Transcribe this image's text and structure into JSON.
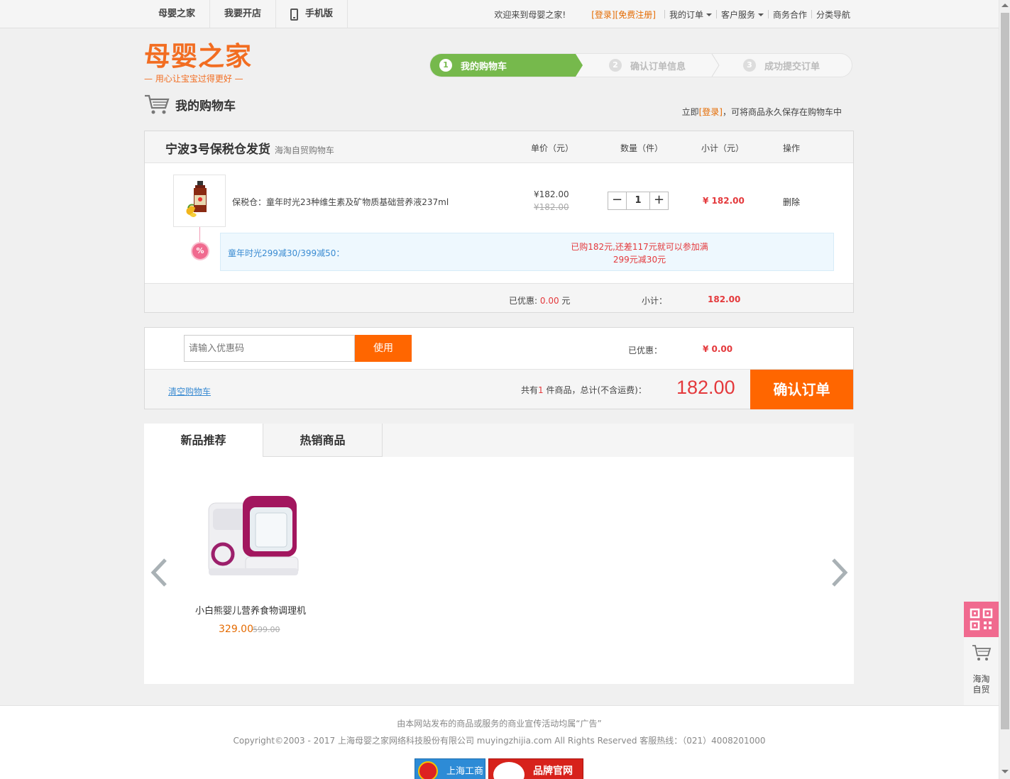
{
  "topbar": {
    "nav": [
      "母婴之家",
      "我要开店",
      "手机版"
    ],
    "welcome": "欢迎来到母婴之家!",
    "login": "[登录]",
    "register": "[免费注册]",
    "my_orders": "我的订单",
    "customer_service": "客户服务",
    "business": "商务合作",
    "category_nav": "分类导航"
  },
  "logo": {
    "title": "母婴之家",
    "slogan": "— 用心让宝宝过得更好 —"
  },
  "steps": [
    {
      "num": "1",
      "label": "我的购物车"
    },
    {
      "num": "2",
      "label": "确认订单信息"
    },
    {
      "num": "3",
      "label": "成功提交订单"
    }
  ],
  "cart": {
    "title": "我的购物车",
    "note_prefix": "立即",
    "note_login": "[登录]",
    "note_suffix": "，可将商品永久保存在购物车中",
    "warehouse": "宁波3号保税仓发货",
    "warehouse_sub": "海淘自贸购物车",
    "columns": {
      "price": "单价（元）",
      "qty": "数量（件）",
      "subtotal": "小计（元）",
      "action": "操作"
    },
    "item": {
      "name": "保税仓：童年时光23种维生素及矿物质基础营养液237ml",
      "price": "¥182.00",
      "price_old": "¥182.00",
      "qty": "1",
      "subtotal": "¥ 182.00",
      "delete": "删除"
    },
    "promo": {
      "badge": "%",
      "name": "童年时光299减30/399减50：",
      "msg1": "已购182元,还差117元就可以参加满",
      "msg2": "299元减30元"
    },
    "footer": {
      "discount_label": "已优惠:",
      "discount_value": "0.00",
      "discount_unit": "元",
      "subtotal_label": "小计：",
      "subtotal_value": "182.00"
    }
  },
  "coupon": {
    "placeholder": "请输入优惠码",
    "use_button": "使用",
    "discount_label": "已优惠：",
    "discount_value": "¥ 0.00",
    "clear_cart": "清空购物车",
    "total_prefix": "共有",
    "total_count": "1",
    "total_suffix": " 件商品，总计(不含运费)：",
    "total_value": "182.00",
    "confirm": "确认订单"
  },
  "recommend": {
    "tabs": [
      "新品推荐",
      "热销商品"
    ],
    "items": [
      {
        "name": "小白熊婴儿营养食物调理机",
        "price": "329.00",
        "old_price": "599.00"
      }
    ]
  },
  "footer": {
    "line1": "由本网站发布的商品或服务的商业宣传活动均属“广告”",
    "line2": "Copyright©2003 - 2017 上海母婴之家网络科技股份有限公司 muyingzhijia.com All Rights Reserved 客服热线：（021）4008201000",
    "badge1": "上海工商",
    "badge2": "品牌官网"
  },
  "side": {
    "cart_label_1": "海淘",
    "cart_label_2": "自贸"
  },
  "colors": {
    "accent_orange": "#ff6600",
    "price_red": "#e4393c",
    "step_green": "#76b94c",
    "promo_pink": "#f06a8f",
    "link_blue": "#3a8bd2"
  }
}
